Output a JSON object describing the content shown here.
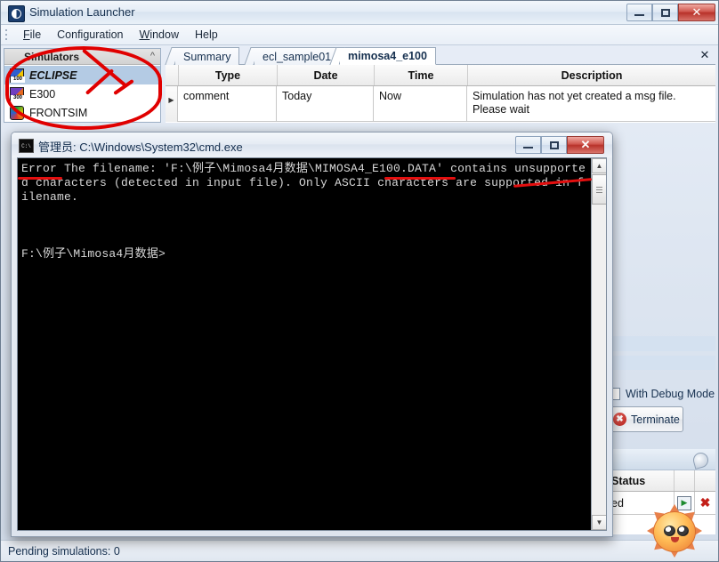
{
  "app": {
    "title": "Simulation Launcher",
    "title_icon": "moon-icon",
    "window_controls": {
      "minimize": "–",
      "maximize": "□",
      "close": "✕"
    }
  },
  "menu": {
    "items": [
      "File",
      "Configuration",
      "Window",
      "Help"
    ]
  },
  "sidebar": {
    "title": "Simulators",
    "collapse_icon": "chevron-up-icon",
    "items": [
      {
        "label": "ECLIPSE",
        "icon": "eclipse-100-icon",
        "selected": true
      },
      {
        "label": "E300",
        "icon": "eclipse-300-icon",
        "selected": false
      },
      {
        "label": "FRONTSIM",
        "icon": "frontsim-icon",
        "selected": false
      }
    ]
  },
  "tabs": {
    "items": [
      {
        "label": "Summary",
        "active": false
      },
      {
        "label": "ecl_sample01",
        "active": false
      },
      {
        "label": "mimosa4_e100",
        "active": true
      }
    ],
    "close_label": "✕"
  },
  "table": {
    "columns": [
      "Type",
      "Date",
      "Time",
      "Description"
    ],
    "rows": [
      {
        "marker": "▶",
        "type": "comment",
        "date": "Today",
        "time": "Now",
        "description": "Simulation has not yet created a msg file. Please wait"
      }
    ]
  },
  "right_panel": {
    "debug_checkbox_label": "With Debug Mode",
    "terminate_label": "Terminate",
    "terminate_icon": "red-x-circle-icon",
    "lower_table": {
      "columns": [
        "Status",
        "",
        ""
      ],
      "rows": [
        {
          "status": "ed",
          "run_icon": "run-icon",
          "delete_icon": "red-x-icon"
        }
      ]
    },
    "tool_icon": "magnifier-icon"
  },
  "statusbar": {
    "text": "Pending simulations: 0"
  },
  "cmd_window": {
    "title": "管理员: C:\\Windows\\System32\\cmd.exe",
    "icon": "console-icon",
    "window_controls": {
      "minimize": "–",
      "maximize": "□",
      "close": "✕"
    },
    "output": "Error The filename: 'F:\\例子\\Mimosa4月数据\\MIMOSA4_E100.DATA' contains unsupported characters (detected in input file). Only ASCII characters are supported in filename.",
    "prompt": "F:\\例子\\Mimosa4月数据>",
    "scrollbar": {
      "up": "▲",
      "down": "▼"
    }
  },
  "annotations": {
    "circle": "red-circle-around-simulators-panel",
    "cross": "red-x-mark",
    "underlines": [
      "Error",
      "MIMOSA4_E100.DATA'",
      "unsupport"
    ],
    "color": "#e00000"
  },
  "sticker": {
    "name": "sun-emoji-sticker"
  }
}
